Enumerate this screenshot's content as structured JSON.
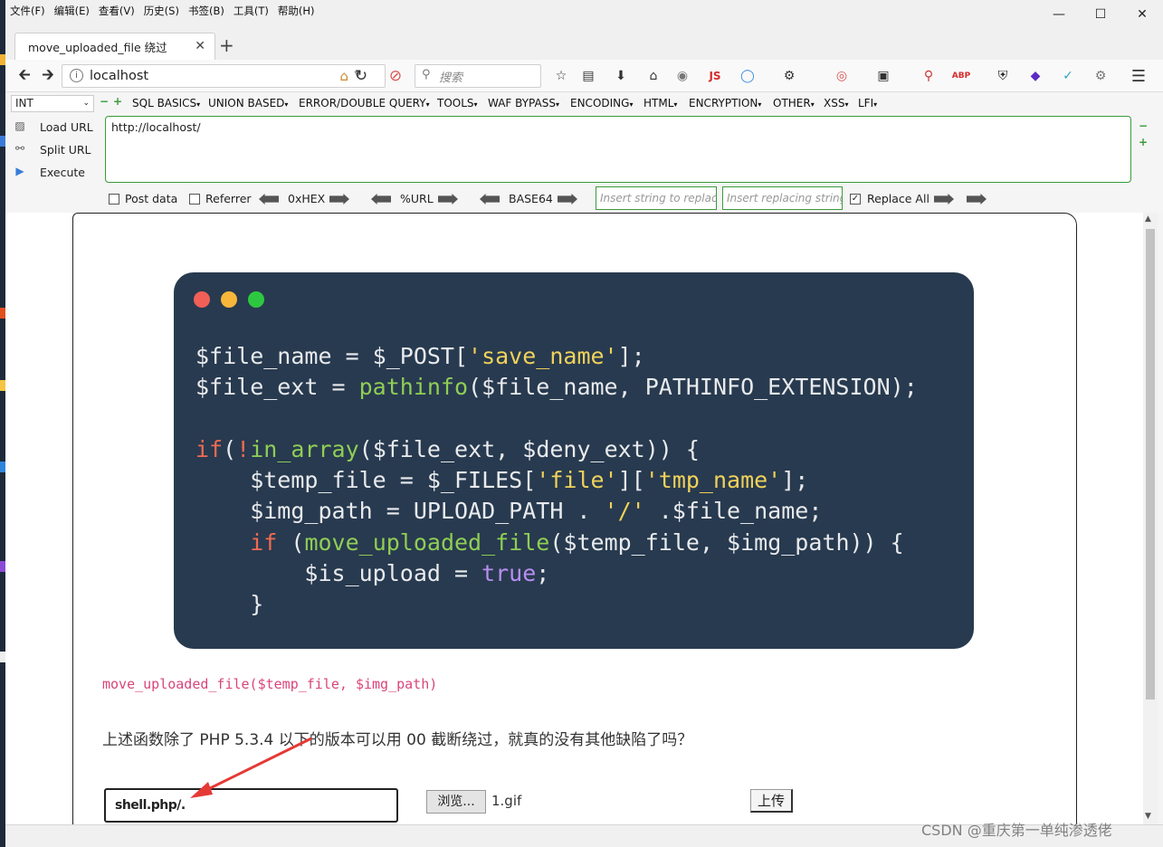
{
  "menubar": [
    "文件(F)",
    "编辑(E)",
    "查看(V)",
    "历史(S)",
    "书签(B)",
    "工具(T)",
    "帮助(H)"
  ],
  "tab": {
    "title": "move_uploaded_file 绕过"
  },
  "nav": {
    "url": "localhost",
    "search_placeholder": "搜索"
  },
  "hackbar": {
    "select": "INT",
    "menus": [
      "SQL BASICS",
      "UNION BASED",
      "ERROR/DOUBLE QUERY",
      "TOOLS",
      "WAF BYPASS",
      "ENCODING",
      "HTML",
      "ENCRYPTION",
      "OTHER",
      "XSS",
      "LFI"
    ],
    "load_url": "Load URL",
    "split_url": "Split URL",
    "execute": "Execute",
    "url_value": "http://localhost/",
    "post_data": "Post data",
    "referrer": "Referrer",
    "hex": "0xHEX",
    "urlenc": "%URL",
    "base64": "BASE64",
    "insert_placeholder": "Insert string to replace",
    "replacing_placeholder": "Insert replacing string",
    "replace_all": "Replace All",
    "replace_all_checked": true
  },
  "code": {
    "lines": [
      [
        [
          "v",
          "$file_name = $_POST["
        ],
        [
          "s",
          "'save_name'"
        ],
        [
          "v",
          "];"
        ]
      ],
      [
        [
          "v",
          "$file_ext = "
        ],
        [
          "f",
          "pathinfo"
        ],
        [
          "v",
          "($file_name, PATHINFO_EXTENSION);"
        ]
      ],
      [
        [
          "v",
          ""
        ]
      ],
      [
        [
          "k",
          "if"
        ],
        [
          "v",
          "("
        ],
        [
          "k",
          "!"
        ],
        [
          "f",
          "in_array"
        ],
        [
          "v",
          "($file_ext, $deny_ext)) {"
        ]
      ],
      [
        [
          "v",
          "    $temp_file = $_FILES["
        ],
        [
          "s",
          "'file'"
        ],
        [
          "v",
          "]["
        ],
        [
          "s",
          "'tmp_name'"
        ],
        [
          "v",
          "];"
        ]
      ],
      [
        [
          "v",
          "    $img_path = UPLOAD_PATH . "
        ],
        [
          "s",
          "'/'"
        ],
        [
          "v",
          " .$file_name;"
        ]
      ],
      [
        [
          "v",
          "    "
        ],
        [
          "k",
          "if"
        ],
        [
          "v",
          " ("
        ],
        [
          "f",
          "move_uploaded_file"
        ],
        [
          "v",
          "($temp_file, $img_path)) {"
        ]
      ],
      [
        [
          "v",
          "        $is_upload = "
        ],
        [
          "b",
          "true"
        ],
        [
          "v",
          ";"
        ]
      ],
      [
        [
          "v",
          "    }"
        ]
      ]
    ]
  },
  "content": {
    "function_call": "move_uploaded_file($temp_file, $img_path)",
    "question": "上述函数除了 PHP 5.3.4 以下的版本可以用 00 截断绕过，就真的没有其他缺陷了吗？",
    "save_name_value": "shell.php/.",
    "browse_label": "浏览...",
    "file_name": "1.gif",
    "upload_label": "上传"
  },
  "watermark": "CSDN @重庆第一单纯渗透佬",
  "colors": {
    "code_bg": "#283a4f",
    "highlight": "#d9457a",
    "arrow": "#e53935"
  }
}
